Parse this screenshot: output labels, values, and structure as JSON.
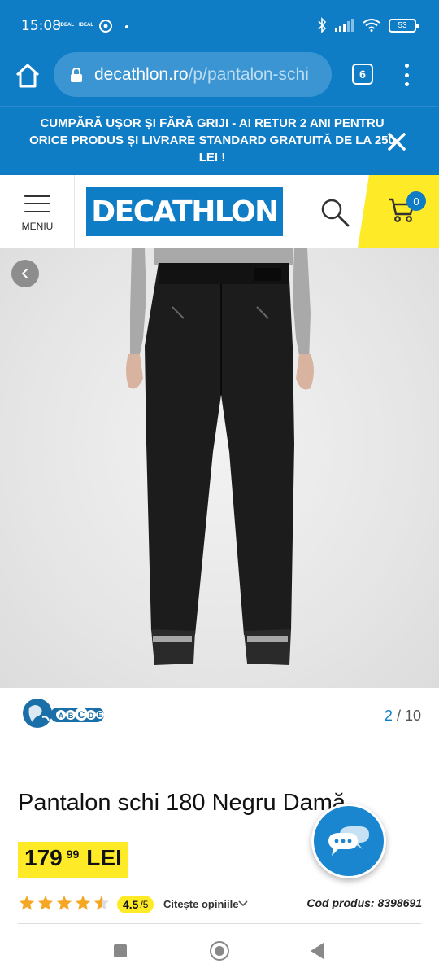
{
  "status_bar": {
    "time": "15:08",
    "carrier1": "IDEAL",
    "carrier2": "IDEAL",
    "battery": "53"
  },
  "browser": {
    "url_domain": "decathlon.ro",
    "url_path": "/p/pantalon-schi",
    "tab_count": "6"
  },
  "promo": {
    "text": "CUMPĂRĂ UȘOR ȘI FĂRĂ GRIJI - AI RETUR 2 ANI PENTRU ORICE PRODUS ȘI LIVRARE STANDARD GRATUITĂ DE LA 250 LEI !"
  },
  "header": {
    "menu_label": "MENIU",
    "logo_text": "DECATHLON",
    "cart_count": "0"
  },
  "gallery": {
    "current": "2",
    "separator": "/",
    "total": "10",
    "eco_letters": [
      "A",
      "B",
      "C",
      "D",
      "E"
    ]
  },
  "product": {
    "title": "Pantalon schi 180 Negru Damă",
    "price_int": "179",
    "price_dec": "99",
    "currency": "LEI",
    "rating": 4.5,
    "rating_value": "4.5",
    "rating_max": "/5",
    "reviews_link": "Citește opiniile",
    "code": "Cod produs: 8398691"
  },
  "colors": {
    "brand_blue": "#0f7cc6",
    "accent_yellow": "#ffea28",
    "star_orange": "#f5a623"
  }
}
